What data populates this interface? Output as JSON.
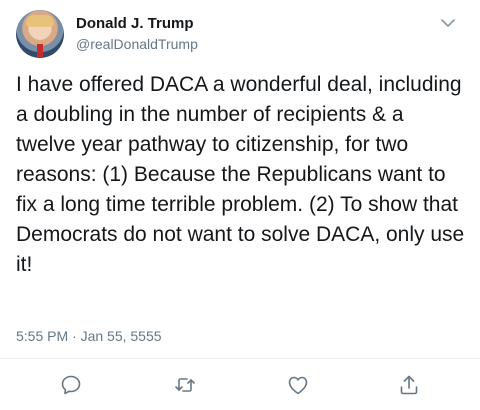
{
  "author": {
    "display_name": "Donald J. Trump",
    "handle": "@realDonaldTrump",
    "avatar_icon": "user-avatar-photo"
  },
  "tweet": {
    "text": "I have offered DACA a wonderful deal, including a doubling in the number of recipients & a twelve year pathway to citizenship, for two reasons: (1) Because the Republicans want to fix a long time terrible problem. (2) To show that Democrats do not want to solve DACA, only use it!",
    "timestamp": "5:55 PM · Jan 55, 5555"
  },
  "actions": [
    {
      "name": "reply",
      "icon": "reply-icon"
    },
    {
      "name": "retweet",
      "icon": "retweet-icon"
    },
    {
      "name": "like",
      "icon": "heart-icon"
    },
    {
      "name": "share",
      "icon": "share-icon"
    }
  ],
  "colors": {
    "text": "#14171a",
    "secondary": "#657786",
    "divider": "#e6ecf0",
    "icon": "#657786"
  }
}
